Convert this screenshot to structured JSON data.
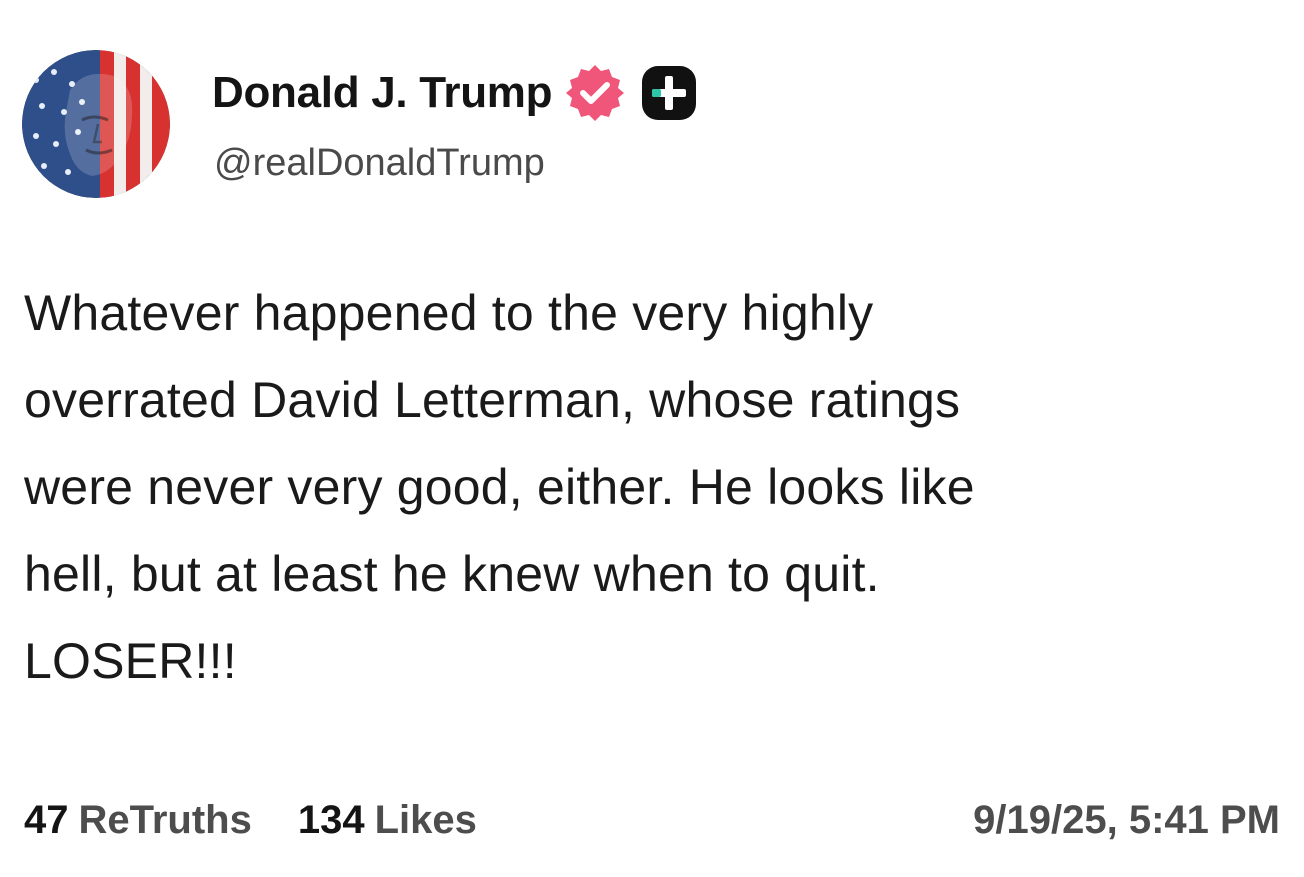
{
  "post": {
    "author": {
      "display_name": "Donald J. Trump",
      "handle": "@realDonaldTrump",
      "avatar_icon": "flag-portrait-avatar",
      "verified_icon": "verified-badge-icon",
      "plus_icon": "plus-badge-icon"
    },
    "body_lines": [
      "Whatever happened to the very highly",
      "overrated David Letterman, whose ratings",
      "were never very good, either. He looks like",
      "hell, but at least he knew when to quit.",
      "LOSER!!!"
    ],
    "stats": {
      "retruths_count": "47",
      "retruths_label": "ReTruths",
      "likes_count": "134",
      "likes_label": "Likes"
    },
    "timestamp": "9/19/25, 5:41 PM"
  },
  "colors": {
    "verified_badge": "#f0557a",
    "plus_badge_bg": "#111111",
    "plus_badge_accent": "#2ec4a6",
    "text_primary": "#141414",
    "text_secondary": "#4d4d4d"
  }
}
